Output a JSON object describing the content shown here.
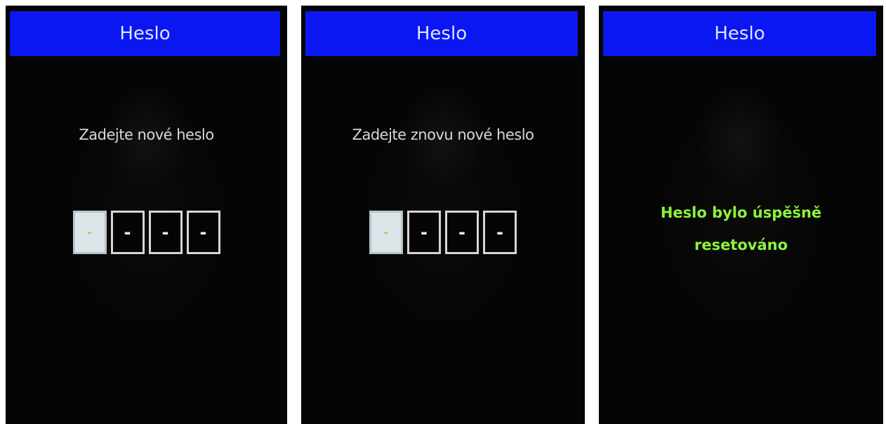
{
  "screens": [
    {
      "title": "Heslo",
      "prompt": "Zadejte nové heslo",
      "pin_digits": [
        "-",
        "-",
        "-",
        "-"
      ]
    },
    {
      "title": "Heslo",
      "prompt": "Zadejte znovu nové heslo",
      "pin_digits": [
        "-",
        "-",
        "-",
        "-"
      ]
    },
    {
      "title": "Heslo",
      "message_line1": "Heslo bylo úspěšně",
      "message_line2": "resetováno"
    }
  ],
  "colors": {
    "title_bar": "#0a17f0",
    "success_text": "#8cf23c",
    "screen_background": "#050505"
  }
}
